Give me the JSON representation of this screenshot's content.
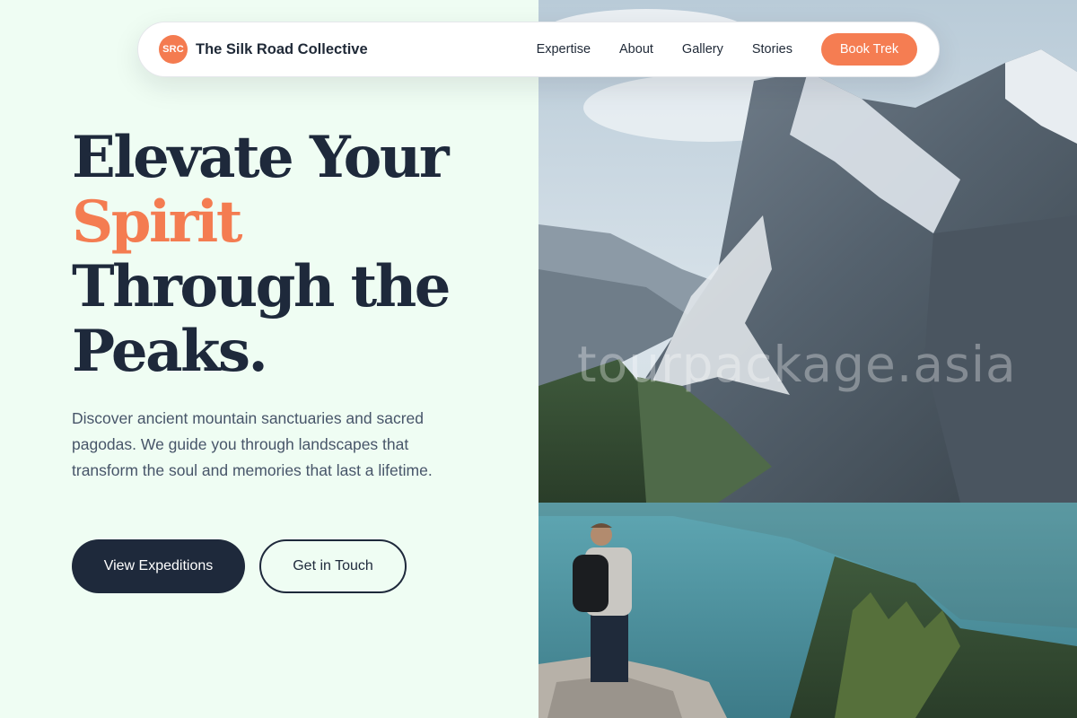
{
  "nav": {
    "logo_text": "SRC",
    "brand": "The Silk Road Collective",
    "links": [
      "Expertise",
      "About",
      "Gallery",
      "Stories"
    ],
    "cta": "Book Trek"
  },
  "hero": {
    "title_line1": "Elevate Your",
    "title_accent": "Spirit",
    "title_line3": "Through the",
    "title_line4": "Peaks.",
    "description": "Discover ancient mountain sanctuaries and sacred pagodas. We guide you through landscapes that transform the soul and memories that last a lifetime.",
    "primary_button": "View Expeditions",
    "secondary_button": "Get in Touch"
  },
  "photo": {
    "watermark": "tourpackage.asia",
    "icon": "mountain-lake-hiker-photo"
  },
  "colors": {
    "accent": "#f47c51",
    "dark": "#1e293b",
    "background": "#effdf2"
  }
}
